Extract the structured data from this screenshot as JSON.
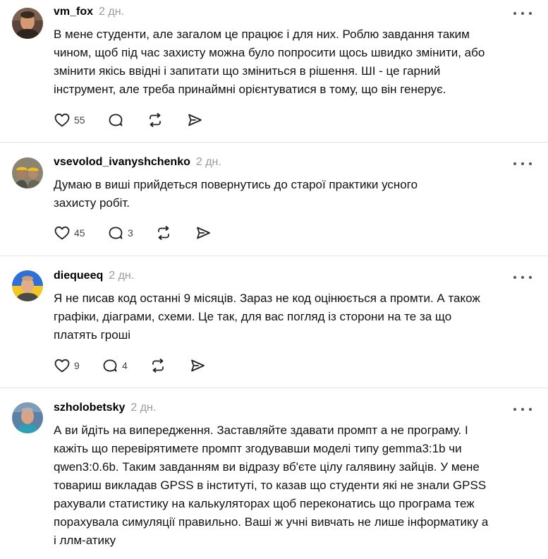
{
  "posts": [
    {
      "username": "vm_fox",
      "time": "2 дн.",
      "lines": [
        "В мене студенти, але загалом це працює і для них. Роблю завдання таким",
        "чином, щоб під час захисту можна було попросити щось швидко змінити, або",
        "змінити якісь ввідні і запитати що зміниться в рішення. ШІ - це гарний",
        "інструмент, але треба принаймні орієнтуватися в тому, що він генерує."
      ],
      "likes": "55",
      "replies": "",
      "avatar_colors": {
        "bg": "#6b4a3a",
        "face": "#d79a72",
        "shirt": "#3a2a22"
      }
    },
    {
      "username": "vsevolod_ivanyshchenko",
      "time": "2 дн.",
      "lines": [
        "Думаю в виші прийдеться повернутись до старої практики усного",
        "захисту робіт."
      ],
      "likes": "45",
      "replies": "3",
      "avatar_colors": {
        "bg": "#8a8272",
        "face": "#b08866",
        "shirt": "#5a5a4a",
        "helmet": "#e8c21a"
      }
    },
    {
      "username": "diequeeq",
      "time": "2 дн.",
      "lines": [
        "Я не писав код останні 9 місяців. Зараз не код оцінюється а промти. А також",
        "графіки, діаграми, схеми. Це так, для вас погляд із сторони на те за що",
        "платять гроші"
      ],
      "likes": "9",
      "replies": "4",
      "avatar_colors": {
        "bg_top": "#2f6fd6",
        "bg_bottom": "#f3c623",
        "face": "#e2b08c",
        "shirt": "#4a4a4a"
      }
    },
    {
      "username": "szholobetsky",
      "time": "2 дн.",
      "lines": [
        "А ви йдіть на випередження. Заставляйте здавати промпт а не програму. І",
        "кажіть що перевірятимете промпт згодувавши моделі типу gemma3:1b чи",
        "qwen3:0.6b. Таким завданням ви відразу вб'єте цілу галявину зайців. У мене",
        "товариш викладав GPSS в інституті, то казав що студенти які не знали GPSS",
        "рахували статистику на калькуляторах щоб переконатись що програма теж",
        "порахувала симуляції правильно. Ваші ж учні вивчать не лише інформатику а",
        "і ллм-атику"
      ],
      "likes": "",
      "replies": "",
      "avatar_colors": {
        "bg": "#5a7fa8",
        "face": "#d9a585",
        "shirt": "#2f9fb8"
      }
    }
  ],
  "icons": {
    "like": "heart-icon",
    "reply": "comment-icon",
    "repost": "repost-icon",
    "share": "send-icon",
    "more": "more-options-icon"
  }
}
